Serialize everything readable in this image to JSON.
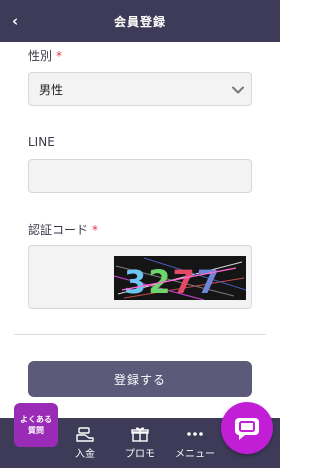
{
  "header": {
    "back_icon": "‹",
    "title": "会員登録"
  },
  "form": {
    "gender": {
      "label": "性別",
      "required_mark": "*",
      "selected": "男性"
    },
    "line": {
      "label": "LINE",
      "value": ""
    },
    "captcha": {
      "label": "認証コード",
      "required_mark": "*",
      "value": "",
      "image_text": "3277"
    },
    "submit_label": "登録する"
  },
  "faq": {
    "line1": "よくある",
    "line2": "質問"
  },
  "bottom_nav": {
    "deposit": "入金",
    "promo": "プロモ",
    "menu": "メニュー"
  },
  "colors": {
    "bar": "#3d3b57",
    "submit": "#5b5a78",
    "faq": "#9a2bb6",
    "chat": "#c21ed6",
    "required": "#e0384a"
  }
}
